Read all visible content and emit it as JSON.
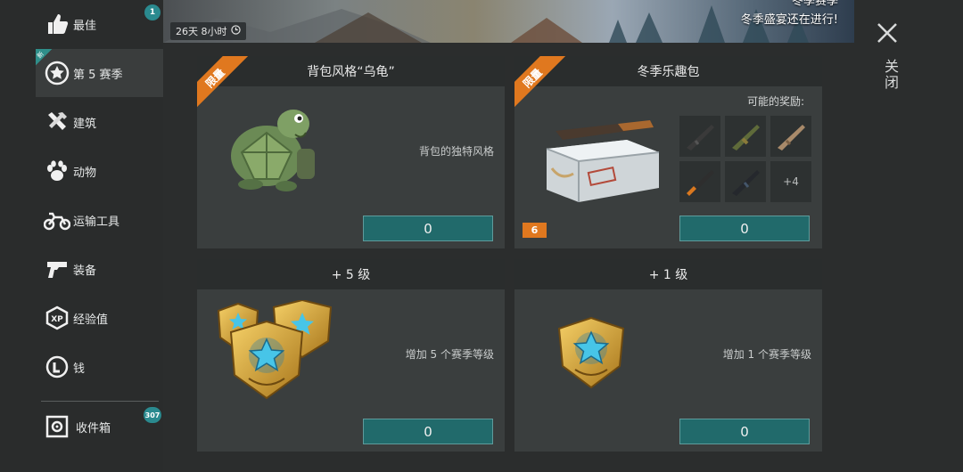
{
  "sidebar": {
    "items": [
      {
        "label": "最佳",
        "icon": "thumbs-up-icon",
        "badge": "1"
      },
      {
        "label": "第 5 赛季",
        "icon": "star-badge-icon",
        "new_flag": "新"
      },
      {
        "label": "建筑",
        "icon": "tools-icon"
      },
      {
        "label": "动物",
        "icon": "paw-icon"
      },
      {
        "label": "运输工具",
        "icon": "motorcycle-icon"
      },
      {
        "label": "装备",
        "icon": "pistol-icon"
      },
      {
        "label": "经验值",
        "icon": "xp-icon"
      },
      {
        "label": "钱",
        "icon": "coin-icon"
      },
      {
        "label": "收件箱",
        "icon": "safe-icon",
        "badge": "307"
      }
    ]
  },
  "banner": {
    "timer": "26天 8小时",
    "line1": "冬季赛季",
    "line2": "冬季盛宴还在进行!"
  },
  "close": {
    "label": "关闭"
  },
  "cards": [
    {
      "title": "背包风格“乌龟”",
      "ribbon": "限量",
      "description": "背包的独特风格",
      "price": "0",
      "image": "turtle-backpack-image"
    },
    {
      "title": "冬季乐趣包",
      "ribbon": "限量",
      "rewards_label": "可能的奖励:",
      "count": "6",
      "more": "+4",
      "price": "0",
      "image": "crate-image"
    },
    {
      "title": "+ 5 级",
      "description": "增加 5 个赛季等级",
      "price": "0",
      "image": "season-badges-image"
    },
    {
      "title": "+ 1 级",
      "description": "增加 1 个赛季等级",
      "price": "0",
      "image": "season-badge-image"
    }
  ],
  "colors": {
    "accent_orange": "#e0781f",
    "button_teal": "#216a6b",
    "badge_teal": "#2a8a8f"
  }
}
